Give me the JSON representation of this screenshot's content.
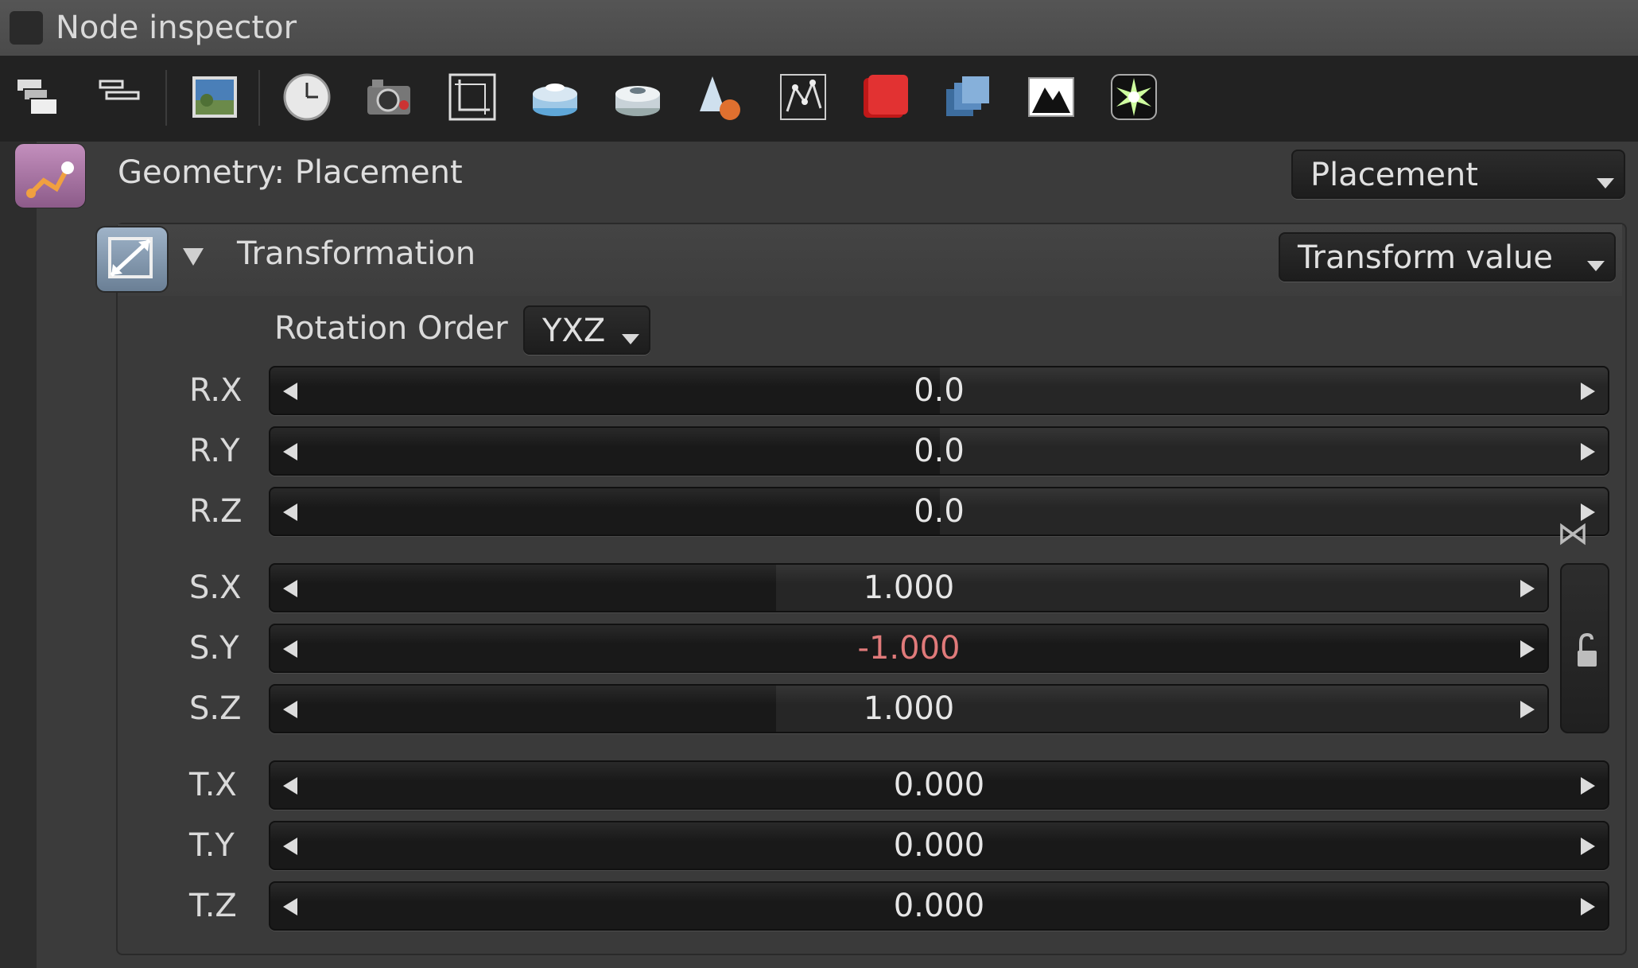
{
  "window": {
    "title": "Node inspector"
  },
  "toolbar": {
    "icons": [
      "stack-windows-icon",
      "align-lines-icon",
      "landscape-image-icon",
      "clock-icon",
      "camera-icon",
      "crop-frame-icon",
      "disc-stack-icon",
      "disc-stack-silver-icon",
      "cone-sphere-icon",
      "network-icon",
      "red-cube-icon",
      "blue-layers-icon",
      "mountain-icon",
      "starburst-icon"
    ]
  },
  "geometry": {
    "label": "Geometry: Placement",
    "mode_value": "Placement"
  },
  "transformation": {
    "label": "Transformation",
    "mode_value": "Transform value",
    "rotation_order_label": "Rotation Order",
    "rotation_order_value": "YXZ",
    "rotation": [
      {
        "label": "R.X",
        "value": "0.0"
      },
      {
        "label": "R.Y",
        "value": "0.0"
      },
      {
        "label": "R.Z",
        "value": "0.0"
      }
    ],
    "scale": [
      {
        "label": "S.X",
        "value": "1.000"
      },
      {
        "label": "S.Y",
        "value": "-1.000"
      },
      {
        "label": "S.Z",
        "value": "1.000"
      }
    ],
    "translation": [
      {
        "label": "T.X",
        "value": "0.000"
      },
      {
        "label": "T.Y",
        "value": "0.000"
      },
      {
        "label": "T.Z",
        "value": "0.000"
      }
    ]
  },
  "colors": {
    "negative_value": "#e07a7a",
    "field_bg": "#191919",
    "panel_bg": "#3b3b3b"
  }
}
